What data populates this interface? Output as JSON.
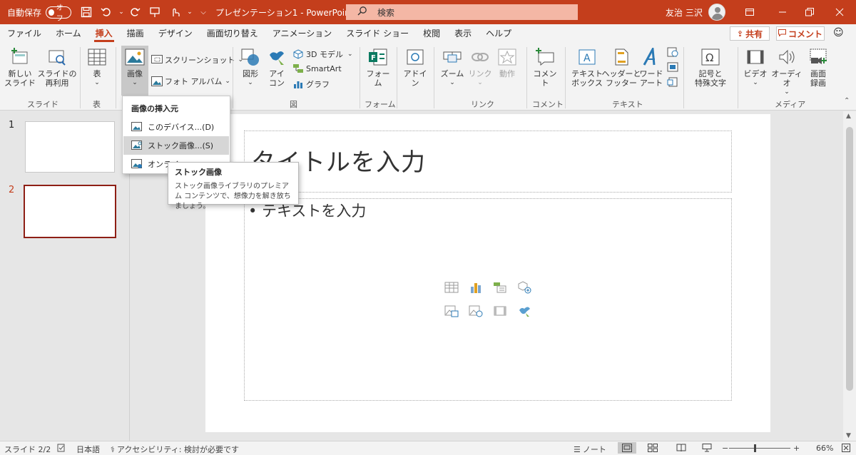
{
  "titlebar": {
    "autosave_label": "自動保存",
    "autosave_state": "オフ",
    "doc_title": "プレゼンテーション1 - PowerPoint",
    "search_placeholder": "検索",
    "user_name": "友治 三沢",
    "accent_color": "#c43e1c"
  },
  "menu": {
    "tabs": [
      "ファイル",
      "ホーム",
      "挿入",
      "描画",
      "デザイン",
      "画面切り替え",
      "アニメーション",
      "スライド ショー",
      "校閲",
      "表示",
      "ヘルプ"
    ],
    "active_tab": "挿入",
    "share_label": "共有",
    "comment_label": "コメント"
  },
  "ribbon": {
    "new_slide": "新しい\nスライド",
    "reuse_slide": "スライドの\n再利用",
    "table": "表",
    "picture": "画像",
    "screenshot": "スクリーンショット",
    "photo_album": "フォト アルバム",
    "shapes": "図形",
    "icons": "アイ\nコン",
    "model3d": "3D モデル",
    "smartart": "SmartArt",
    "graph": "グラフ",
    "forms": "フォー\nム",
    "addins": "アドイ\nン",
    "zoom": "ズーム",
    "link": "リンク",
    "action": "動作",
    "comment": "コメント",
    "textbox": "テキスト\nボックス",
    "header_footer": "ヘッダーと\nフッター",
    "wordart": "ワード\nアート",
    "symbols": "記号と\n特殊文字",
    "video": "ビデオ",
    "audio": "オーディオ",
    "screen_record": "画面\n録画",
    "groups": {
      "slides": "スライド",
      "table": "表",
      "images": "図",
      "forms": "フォーム",
      "links": "リンク",
      "comments": "コメント",
      "text": "テキスト",
      "media": "メディア"
    }
  },
  "dropdown": {
    "header": "画像の挿入元",
    "items": [
      "このデバイス...(D)",
      "ストック画像...(S)",
      "オンライ"
    ]
  },
  "tooltip": {
    "title": "ストック画像",
    "description": "ストック画像ライブラリのプレミアム コンテンツで、想像力を解き放ちましょう。"
  },
  "thumbnails": {
    "numbers": [
      "1",
      "2"
    ]
  },
  "slide": {
    "title_placeholder": "タイトルを入力",
    "body_placeholder": "• テキストを入力"
  },
  "status": {
    "slide_info": "スライド 2/2",
    "language": "日本語",
    "accessibility": "アクセシビリティ: 検討が必要です",
    "notes": "ノート",
    "zoom_value": "66%"
  }
}
